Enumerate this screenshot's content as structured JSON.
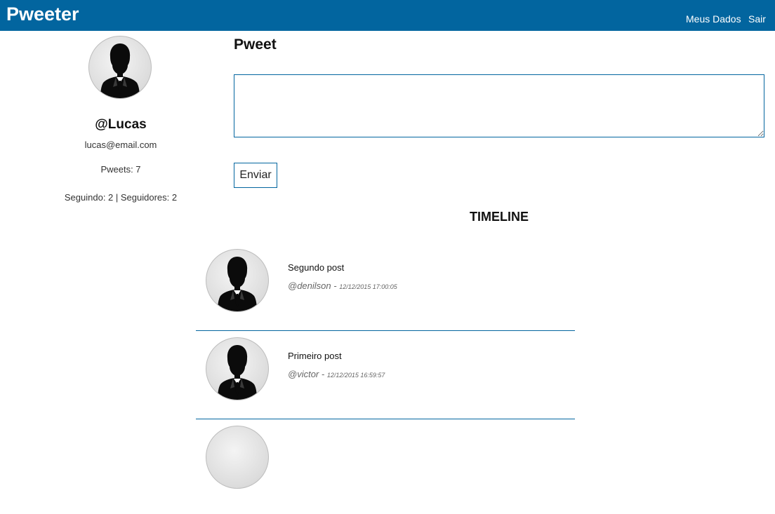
{
  "app": {
    "brand": "Pweeter",
    "nav": [
      {
        "label": "Meus Dados"
      },
      {
        "label": "Sair"
      }
    ]
  },
  "profile": {
    "handle": "@Lucas",
    "email": "lucas@email.com",
    "pweets": "Pweets: 7",
    "follow": "Seguindo: 2 | Seguidores: 2"
  },
  "compose": {
    "title": "Pweet",
    "value": "",
    "button_label": "Enviar"
  },
  "timeline": {
    "title": "TIMELINE",
    "posts": [
      {
        "text": "Segundo post",
        "author": "@denilson",
        "sep": " - ",
        "timestamp": "12/12/2015 17:00:05"
      },
      {
        "text": "Primeiro post",
        "author": "@victor",
        "sep": " - ",
        "timestamp": "12/12/2015 16:59:57"
      }
    ]
  },
  "icons": {
    "avatar": "user-silhouette-icon"
  },
  "colors": {
    "brand": "#02659f",
    "background": "#ffffff"
  }
}
